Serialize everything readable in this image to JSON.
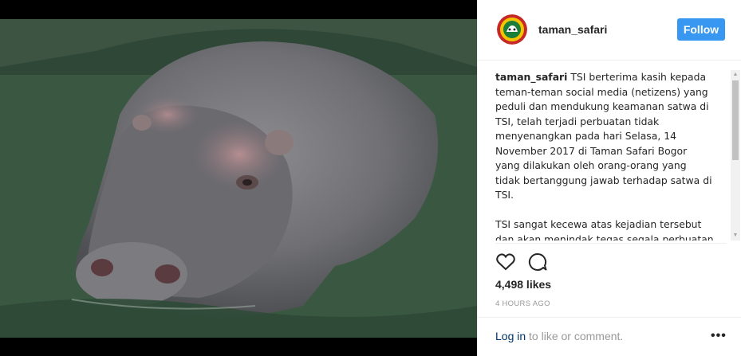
{
  "post": {
    "username": "taman_safari",
    "follow_label": "Follow",
    "caption_user": "taman_safari",
    "caption_text": " TSI berterima kasih kepada\nteman-teman social media (netizens) yang\npeduli dan mendukung keamanan satwa di\nTSI, telah terjadi perbuatan tidak\nmenyenangkan pada hari Selasa, 14\nNovember 2017 di Taman Safari Bogor\nyang dilakukan oleh orang-orang yang\ntidak bertanggung jawab terhadap satwa di\nTSI.\n\nTSI sangat kecewa atas kejadian tersebut\ndan akan menindak tegas segala perbuatan",
    "likes": "4,498 likes",
    "timestamp": "4 HOURS AGO",
    "login_link": "Log in",
    "login_rest": " to like or comment.",
    "more_label": "•••"
  },
  "icons": {
    "like": "heart-icon",
    "comment": "comment-icon",
    "more": "more-options-icon",
    "avatar": "taman-safari-logo"
  },
  "colors": {
    "follow_button": "#3897f0",
    "link": "#003569",
    "muted": "#999999",
    "text": "#262626"
  }
}
